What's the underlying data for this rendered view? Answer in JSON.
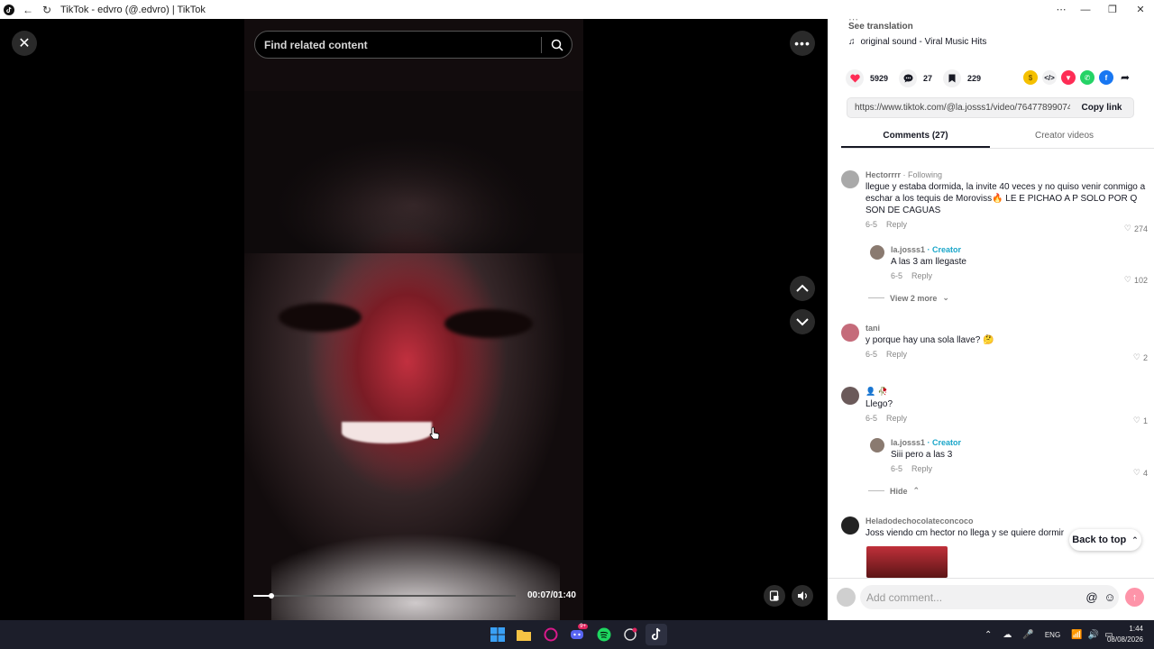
{
  "window": {
    "title": "TikTok - edvro (@.edvro) | TikTok",
    "controls": [
      "more",
      "minimize",
      "restore",
      "close"
    ]
  },
  "player": {
    "search_placeholder": "Find related content",
    "current_time": "00:07",
    "duration": "01:40",
    "timecode": "00:07/01:40",
    "progress_fraction": 0.07
  },
  "details": {
    "see_translation": "See translation",
    "music": "original sound - Viral Music Hits",
    "likes": "5929",
    "comments": "27",
    "saves": "229",
    "url": "https://www.tiktok.com/@la.josss1/video/76477899074...",
    "copy_link": "Copy link"
  },
  "tabs": {
    "comments": "Comments (27)",
    "creator_videos": "Creator videos"
  },
  "comments": [
    {
      "user": "Hectorrrr",
      "relation": "· Following",
      "text": "llegue y estaba dormida, la invite 40 veces y no quiso venir conmigo a eschar a los tequis de Moroviss🔥 LE E PICHAO A P SOLO POR Q SON DE CAGUAS",
      "date": "6-5",
      "reply_label": "Reply",
      "likes": "274"
    },
    {
      "user": "la.josss1",
      "relation": "· Creator",
      "text": "A las 3 am llegaste",
      "date": "6-5",
      "reply_label": "Reply",
      "likes": "102"
    },
    {
      "view_more": "View 2 more"
    },
    {
      "user": "tani",
      "text": "y porque hay una sola llave? 🤔",
      "date": "6-5",
      "reply_label": "Reply",
      "likes": "2"
    },
    {
      "user": "👤 🥀",
      "text": "Llego?",
      "date": "6-5",
      "reply_label": "Reply",
      "likes": "1"
    },
    {
      "user": "la.josss1",
      "relation": "· Creator",
      "text": "Siii pero a las 3",
      "date": "6-5",
      "reply_label": "Reply",
      "likes": "4"
    },
    {
      "hide": "Hide"
    },
    {
      "user": "Heladodechocolateconcoco",
      "text": "Joss viendo cm hector no llega y se quiere dormir"
    }
  ],
  "back_to_top": "Back to top",
  "add_comment_placeholder": "Add comment...",
  "taskbar": {
    "apps": [
      "start",
      "file-explorer",
      "opera-gx",
      "discord",
      "spotify",
      "chatgpt",
      "tiktok"
    ],
    "discord_badge": "9+",
    "language": "ENG",
    "time": "1:44",
    "date": "08/08/2026"
  },
  "colors": {
    "accent": "#fe2c55",
    "creator_tag": "#1aa6c9",
    "taskbar": "#1c1e2a"
  }
}
